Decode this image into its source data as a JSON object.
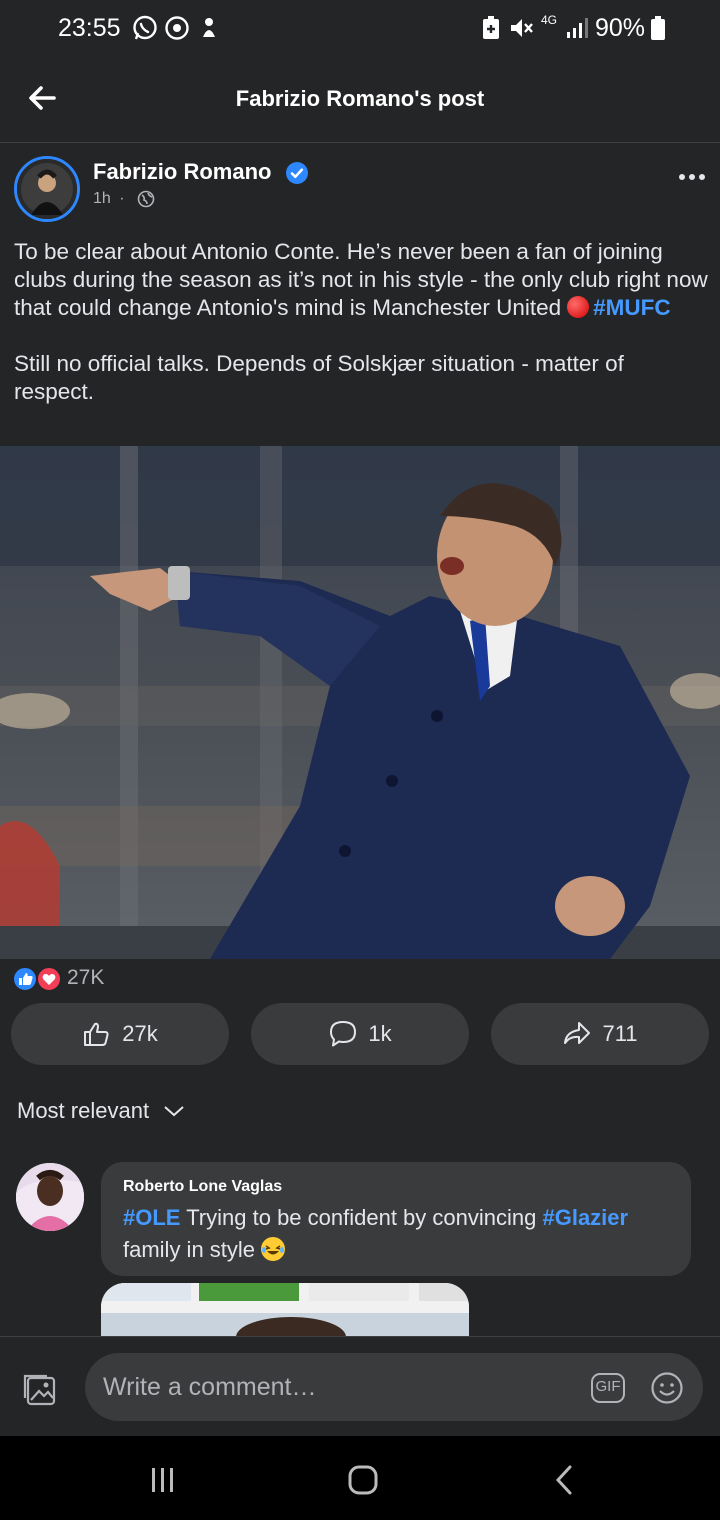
{
  "status_bar": {
    "time": "23:55",
    "battery": "90%",
    "network": "4G",
    "icons": [
      "whatsapp-icon",
      "messenger-icon",
      "notification-icon",
      "battery-saver-icon",
      "mute-icon",
      "signal-icon",
      "battery-icon"
    ]
  },
  "header": {
    "title": "Fabrizio Romano's post"
  },
  "post": {
    "author": "Fabrizio Romano",
    "time": "1h",
    "separator": "·",
    "text_1": "To be clear about Antonio Conte. He’s never been a fan of joining clubs during the season as it’s not in his style - the only club right now that could change Antonio's mind is Manchester United",
    "hashtag_1": "#MUFC",
    "text_2": "Still no official talks. Depends of Solskjær situation - matter of respect."
  },
  "reactions": {
    "total": "27K"
  },
  "actions": {
    "like_count": "27k",
    "comment_count": "1k",
    "share_count": "711"
  },
  "comments_sort": {
    "label": "Most relevant"
  },
  "comment": {
    "author": "Roberto Lone Vaglas",
    "hashtag_1": "#OLE",
    "text_1": "Trying to be confident by convincing",
    "hashtag_2": "#Glazier",
    "text_2": "family in style"
  },
  "composer": {
    "placeholder": "Write a comment…",
    "gif_label": "GIF"
  },
  "colors": {
    "background": "#242526",
    "pill": "#3a3b3c",
    "link": "#4599ff",
    "verified": "#2d88ff"
  }
}
